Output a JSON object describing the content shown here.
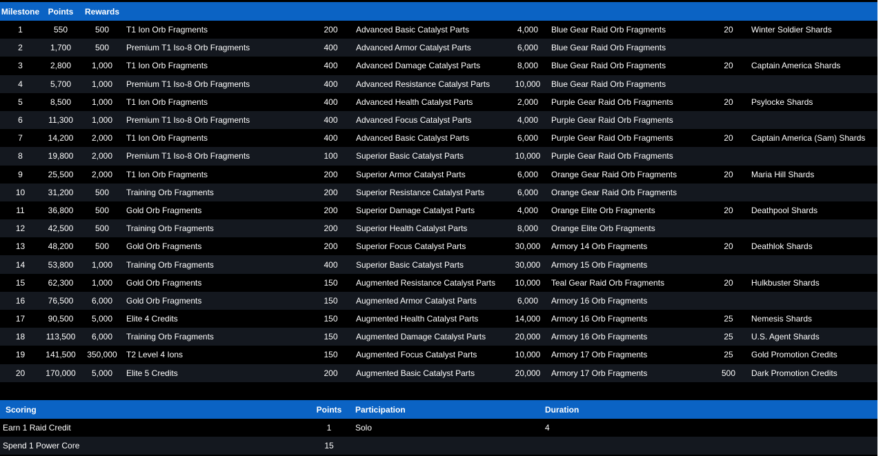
{
  "headers": {
    "milestone": "Milestone",
    "points": "Points",
    "rewards": "Rewards"
  },
  "rows": [
    {
      "m": "1",
      "p": "550",
      "r1q": "500",
      "r1": "T1 Ion Orb Fragments",
      "r2q": "200",
      "r2": "Advanced Basic Catalyst Parts",
      "r3q": "4,000",
      "r3": "Blue Gear Raid Orb Fragments",
      "r4q": "20",
      "r4": "Winter Soldier Shards"
    },
    {
      "m": "2",
      "p": "1,700",
      "r1q": "500",
      "r1": "Premium T1 Iso-8 Orb Fragments",
      "r2q": "400",
      "r2": "Advanced Armor Catalyst Parts",
      "r3q": "6,000",
      "r3": "Blue Gear Raid Orb Fragments",
      "r4q": "",
      "r4": ""
    },
    {
      "m": "3",
      "p": "2,800",
      "r1q": "1,000",
      "r1": "T1 Ion Orb Fragments",
      "r2q": "400",
      "r2": "Advanced Damage Catalyst Parts",
      "r3q": "8,000",
      "r3": "Blue Gear Raid Orb Fragments",
      "r4q": "20",
      "r4": "Captain America Shards"
    },
    {
      "m": "4",
      "p": "5,700",
      "r1q": "1,000",
      "r1": "Premium T1 Iso-8 Orb Fragments",
      "r2q": "400",
      "r2": "Advanced Resistance Catalyst Parts",
      "r3q": "10,000",
      "r3": "Blue Gear Raid Orb Fragments",
      "r4q": "",
      "r4": ""
    },
    {
      "m": "5",
      "p": "8,500",
      "r1q": "1,000",
      "r1": "T1 Ion Orb Fragments",
      "r2q": "400",
      "r2": "Advanced Health Catalyst Parts",
      "r3q": "2,000",
      "r3": "Purple Gear Raid Orb Fragments",
      "r4q": "20",
      "r4": "Psylocke Shards"
    },
    {
      "m": "6",
      "p": "11,300",
      "r1q": "1,000",
      "r1": "Premium T1 Iso-8 Orb Fragments",
      "r2q": "400",
      "r2": "Advanced Focus Catalyst Parts",
      "r3q": "4,000",
      "r3": "Purple Gear Raid Orb Fragments",
      "r4q": "",
      "r4": ""
    },
    {
      "m": "7",
      "p": "14,200",
      "r1q": "2,000",
      "r1": "T1 Ion Orb Fragments",
      "r2q": "400",
      "r2": "Advanced Basic Catalyst Parts",
      "r3q": "6,000",
      "r3": "Purple Gear Raid Orb Fragments",
      "r4q": "20",
      "r4": "Captain America (Sam) Shards"
    },
    {
      "m": "8",
      "p": "19,800",
      "r1q": "2,000",
      "r1": "Premium T1 Iso-8 Orb Fragments",
      "r2q": "100",
      "r2": "Superior Basic Catalyst Parts",
      "r3q": "10,000",
      "r3": "Purple Gear Raid Orb Fragments",
      "r4q": "",
      "r4": ""
    },
    {
      "m": "9",
      "p": "25,500",
      "r1q": "2,000",
      "r1": "T1 Ion Orb Fragments",
      "r2q": "200",
      "r2": "Superior Armor Catalyst Parts",
      "r3q": "6,000",
      "r3": "Orange Gear Raid Orb Fragments",
      "r4q": "20",
      "r4": "Maria Hill Shards"
    },
    {
      "m": "10",
      "p": "31,200",
      "r1q": "500",
      "r1": "Training Orb Fragments",
      "r2q": "200",
      "r2": "Superior Resistance Catalyst Parts",
      "r3q": "6,000",
      "r3": "Orange Gear Raid Orb Fragments",
      "r4q": "",
      "r4": ""
    },
    {
      "m": "11",
      "p": "36,800",
      "r1q": "500",
      "r1": "Gold Orb Fragments",
      "r2q": "200",
      "r2": "Superior Damage Catalyst Parts",
      "r3q": "4,000",
      "r3": "Orange Elite Orb Fragments",
      "r4q": "20",
      "r4": "Deathpool Shards"
    },
    {
      "m": "12",
      "p": "42,500",
      "r1q": "500",
      "r1": "Training Orb Fragments",
      "r2q": "200",
      "r2": "Superior Health Catalyst Parts",
      "r3q": "8,000",
      "r3": "Orange Elite Orb Fragments",
      "r4q": "",
      "r4": ""
    },
    {
      "m": "13",
      "p": "48,200",
      "r1q": "500",
      "r1": "Gold Orb Fragments",
      "r2q": "200",
      "r2": "Superior Focus Catalyst Parts",
      "r3q": "30,000",
      "r3": "Armory 14 Orb Fragments",
      "r4q": "20",
      "r4": "Deathlok Shards"
    },
    {
      "m": "14",
      "p": "53,800",
      "r1q": "1,000",
      "r1": "Training Orb Fragments",
      "r2q": "400",
      "r2": "Superior Basic Catalyst Parts",
      "r3q": "30,000",
      "r3": "Armory 15 Orb Fragments",
      "r4q": "",
      "r4": ""
    },
    {
      "m": "15",
      "p": "62,300",
      "r1q": "1,000",
      "r1": "Gold Orb Fragments",
      "r2q": "150",
      "r2": "Augmented Resistance Catalyst Parts",
      "r3q": "10,000",
      "r3": "Teal Gear Raid Orb Fragments",
      "r4q": "20",
      "r4": "Hulkbuster Shards"
    },
    {
      "m": "16",
      "p": "76,500",
      "r1q": "6,000",
      "r1": "Gold Orb Fragments",
      "r2q": "150",
      "r2": "Augmented Armor Catalyst Parts",
      "r3q": "6,000",
      "r3": "Armory 16 Orb Fragments",
      "r4q": "",
      "r4": ""
    },
    {
      "m": "17",
      "p": "90,500",
      "r1q": "5,000",
      "r1": "Elite 4 Credits",
      "r2q": "150",
      "r2": "Augmented Health Catalyst Parts",
      "r3q": "14,000",
      "r3": "Armory 16 Orb Fragments",
      "r4q": "25",
      "r4": "Nemesis Shards"
    },
    {
      "m": "18",
      "p": "113,500",
      "r1q": "6,000",
      "r1": "Training Orb Fragments",
      "r2q": "150",
      "r2": "Augmented Damage Catalyst Parts",
      "r3q": "20,000",
      "r3": "Armory 16 Orb Fragments",
      "r4q": "25",
      "r4": "U.S. Agent Shards"
    },
    {
      "m": "19",
      "p": "141,500",
      "r1q": "350,000",
      "r1": "T2 Level 4 Ions",
      "r2q": "150",
      "r2": "Augmented Focus Catalyst Parts",
      "r3q": "10,000",
      "r3": "Armory 17 Orb Fragments",
      "r4q": "25",
      "r4": "Gold Promotion Credits"
    },
    {
      "m": "20",
      "p": "170,000",
      "r1q": "5,000",
      "r1": "Elite 5 Credits",
      "r2q": "200",
      "r2": "Augmented Basic Catalyst Parts",
      "r3q": "20,000",
      "r3": "Armory 17 Orb Fragments",
      "r4q": "500",
      "r4": "Dark Promotion Credits"
    }
  ],
  "scoring": {
    "headers": {
      "scoring": "Scoring",
      "points": "Points",
      "participation": "Participation",
      "duration": "Duration"
    },
    "rows": [
      {
        "action": "Earn 1 Raid Credit",
        "points": "1",
        "participation": "Solo",
        "duration": "4"
      },
      {
        "action": "Spend 1 Power Core",
        "points": "15",
        "participation": "",
        "duration": ""
      }
    ]
  }
}
